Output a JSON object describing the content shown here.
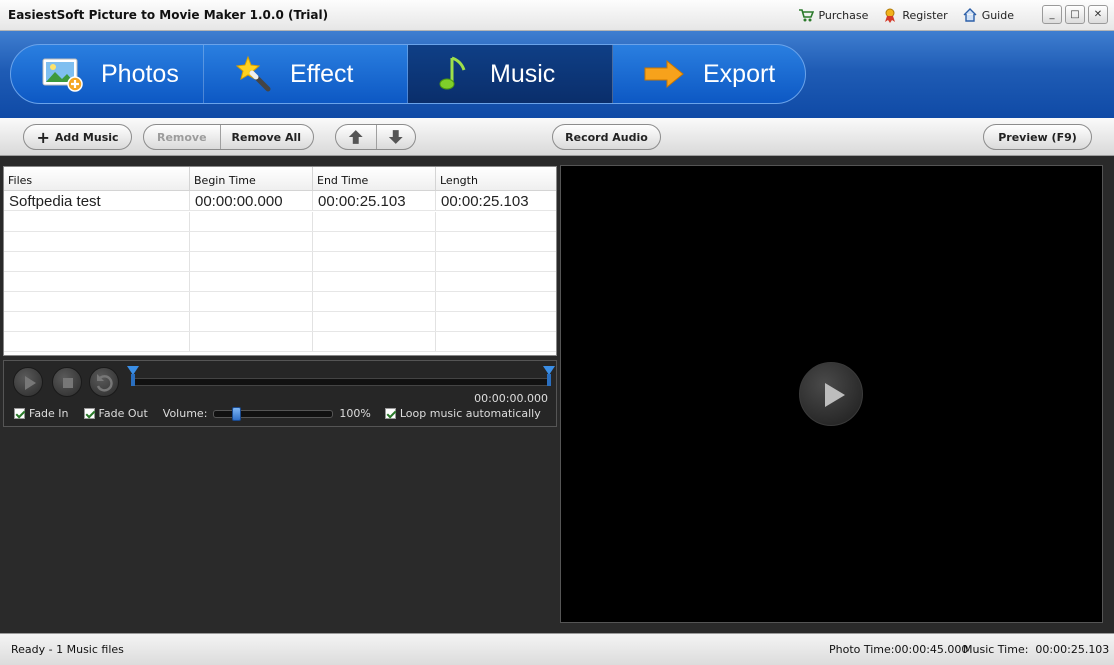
{
  "window": {
    "title": "EasiestSoft Picture to Movie Maker 1.0.0 (Trial)",
    "links": [
      {
        "label": "Purchase",
        "icon": "cart-icon"
      },
      {
        "label": "Register",
        "icon": "register-icon"
      },
      {
        "label": "Guide",
        "icon": "home-icon"
      }
    ]
  },
  "nav": {
    "tabs": [
      {
        "label": "Photos",
        "icon": "photo-add-icon",
        "active": false
      },
      {
        "label": "Effect",
        "icon": "magic-wand-icon",
        "active": false
      },
      {
        "label": "Music",
        "icon": "music-note-icon",
        "active": true
      },
      {
        "label": "Export",
        "icon": "arrow-right-icon",
        "active": false
      }
    ]
  },
  "toolbar": {
    "add_music": "Add Music",
    "remove": "Remove",
    "remove_all": "Remove All",
    "record_audio": "Record Audio",
    "preview": "Preview (F9)"
  },
  "filelist": {
    "columns": [
      "Files",
      "Begin Time",
      "End Time",
      "Length"
    ],
    "rows": [
      {
        "file": "Softpedia test",
        "begin": "00:00:00.000",
        "end": "00:00:25.103",
        "length": "00:00:25.103"
      }
    ]
  },
  "player": {
    "timecode": "00:00:00.000",
    "fade_in": "Fade In",
    "fade_out": "Fade Out",
    "volume_label": "Volume:",
    "volume_value": "100%",
    "volume_level": 0.18,
    "loop": "Loop music automatically"
  },
  "status": {
    "left": "Ready - 1 Music files",
    "photo_time": "Photo Time:00:00:45.000",
    "music_time": "Music Time:  00:00:25.103"
  },
  "colors": {
    "header_blue": "#1f5cb5",
    "active_tab": "#0a2e6b",
    "accent_blue": "#2f6fc7"
  }
}
